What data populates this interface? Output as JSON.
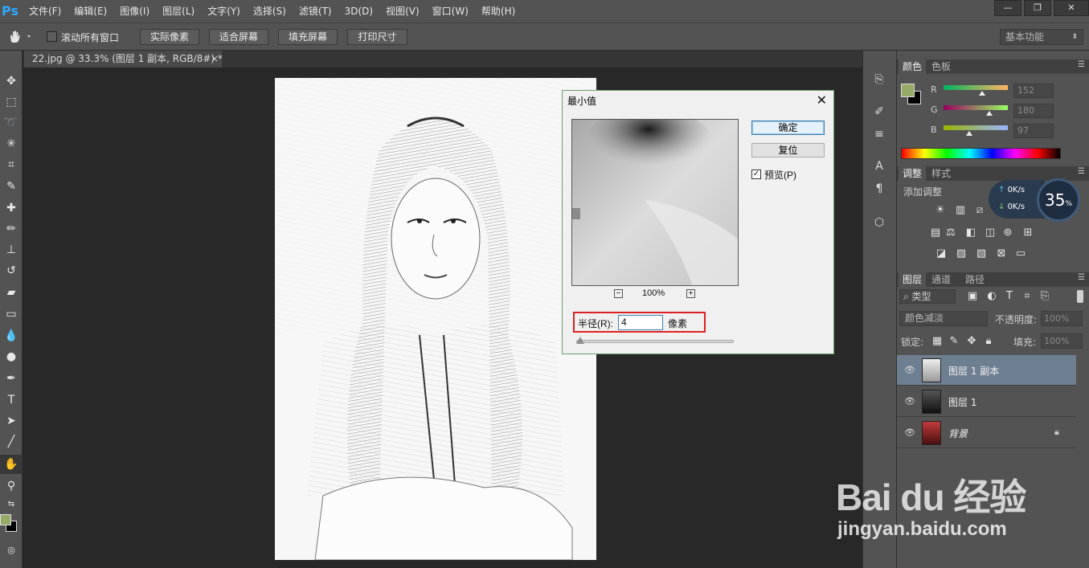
{
  "app": {
    "logo": "Ps"
  },
  "menu": [
    "文件(F)",
    "编辑(E)",
    "图像(I)",
    "图层(L)",
    "文字(Y)",
    "选择(S)",
    "滤镜(T)",
    "3D(D)",
    "视图(V)",
    "窗口(W)",
    "帮助(H)"
  ],
  "window_controls": {
    "minimize": "—",
    "restore": "❐",
    "close": "✕"
  },
  "options": {
    "scroll_all_label": "滚动所有窗口",
    "buttons": [
      "实际像素",
      "适合屏幕",
      "填充屏幕",
      "打印尺寸"
    ],
    "workspace": "基本功能"
  },
  "document": {
    "tab_title": "22.jpg @ 33.3% (图层 1 副本, RGB/8#) *",
    "close": "×"
  },
  "dialog": {
    "title": "最小值",
    "close": "✕",
    "ok": "确定",
    "reset": "复位",
    "preview_label": "预览(P)",
    "preview_checked": "✓",
    "zoom_out": "−",
    "zoom_in": "+",
    "zoom": "100%",
    "radius_label": "半径(R):",
    "radius_value": "4",
    "radius_unit": "像素",
    "radius_slider_level": 0.01
  },
  "color_panel": {
    "tabs": [
      "颜色",
      "色板"
    ],
    "fg_color": "#96ab68",
    "bg_color": "#000000",
    "channels": [
      {
        "label": "R",
        "value": "152"
      },
      {
        "label": "G",
        "value": "180"
      },
      {
        "label": "B",
        "value": "97"
      }
    ]
  },
  "adjust_panel": {
    "tabs": [
      "调整",
      "样式"
    ],
    "title": "添加调整"
  },
  "network": {
    "up": "0K/s",
    "down": "0K/s",
    "percent": "35",
    "percent_unit": "%"
  },
  "layers_panel": {
    "tabs": [
      "图层",
      "通道",
      "路径"
    ],
    "filter_kind": "类型",
    "blend_mode": "颜色减淡",
    "opacity_label": "不透明度:",
    "opacity": "100%",
    "lock_label": "锁定:",
    "fill_label": "填充:",
    "fill": "100%",
    "layers": [
      {
        "name": "图层 1 副本",
        "selected": true
      },
      {
        "name": "图层 1",
        "selected": false
      },
      {
        "name": "背景",
        "selected": false,
        "locked": true
      }
    ]
  },
  "watermark": {
    "text": "Bai du 经验",
    "url": "jingyan.baidu.com"
  }
}
